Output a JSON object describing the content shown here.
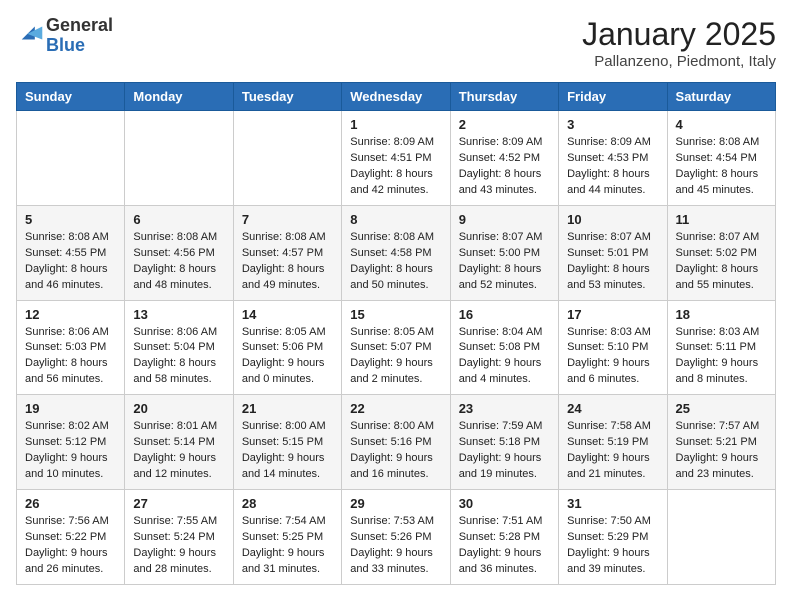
{
  "header": {
    "logo_line1": "General",
    "logo_line2": "Blue",
    "month_title": "January 2025",
    "location": "Pallanzeno, Piedmont, Italy"
  },
  "days_of_week": [
    "Sunday",
    "Monday",
    "Tuesday",
    "Wednesday",
    "Thursday",
    "Friday",
    "Saturday"
  ],
  "weeks": [
    [
      {
        "day": "",
        "text": ""
      },
      {
        "day": "",
        "text": ""
      },
      {
        "day": "",
        "text": ""
      },
      {
        "day": "1",
        "text": "Sunrise: 8:09 AM\nSunset: 4:51 PM\nDaylight: 8 hours\nand 42 minutes."
      },
      {
        "day": "2",
        "text": "Sunrise: 8:09 AM\nSunset: 4:52 PM\nDaylight: 8 hours\nand 43 minutes."
      },
      {
        "day": "3",
        "text": "Sunrise: 8:09 AM\nSunset: 4:53 PM\nDaylight: 8 hours\nand 44 minutes."
      },
      {
        "day": "4",
        "text": "Sunrise: 8:08 AM\nSunset: 4:54 PM\nDaylight: 8 hours\nand 45 minutes."
      }
    ],
    [
      {
        "day": "5",
        "text": "Sunrise: 8:08 AM\nSunset: 4:55 PM\nDaylight: 8 hours\nand 46 minutes."
      },
      {
        "day": "6",
        "text": "Sunrise: 8:08 AM\nSunset: 4:56 PM\nDaylight: 8 hours\nand 48 minutes."
      },
      {
        "day": "7",
        "text": "Sunrise: 8:08 AM\nSunset: 4:57 PM\nDaylight: 8 hours\nand 49 minutes."
      },
      {
        "day": "8",
        "text": "Sunrise: 8:08 AM\nSunset: 4:58 PM\nDaylight: 8 hours\nand 50 minutes."
      },
      {
        "day": "9",
        "text": "Sunrise: 8:07 AM\nSunset: 5:00 PM\nDaylight: 8 hours\nand 52 minutes."
      },
      {
        "day": "10",
        "text": "Sunrise: 8:07 AM\nSunset: 5:01 PM\nDaylight: 8 hours\nand 53 minutes."
      },
      {
        "day": "11",
        "text": "Sunrise: 8:07 AM\nSunset: 5:02 PM\nDaylight: 8 hours\nand 55 minutes."
      }
    ],
    [
      {
        "day": "12",
        "text": "Sunrise: 8:06 AM\nSunset: 5:03 PM\nDaylight: 8 hours\nand 56 minutes."
      },
      {
        "day": "13",
        "text": "Sunrise: 8:06 AM\nSunset: 5:04 PM\nDaylight: 8 hours\nand 58 minutes."
      },
      {
        "day": "14",
        "text": "Sunrise: 8:05 AM\nSunset: 5:06 PM\nDaylight: 9 hours\nand 0 minutes."
      },
      {
        "day": "15",
        "text": "Sunrise: 8:05 AM\nSunset: 5:07 PM\nDaylight: 9 hours\nand 2 minutes."
      },
      {
        "day": "16",
        "text": "Sunrise: 8:04 AM\nSunset: 5:08 PM\nDaylight: 9 hours\nand 4 minutes."
      },
      {
        "day": "17",
        "text": "Sunrise: 8:03 AM\nSunset: 5:10 PM\nDaylight: 9 hours\nand 6 minutes."
      },
      {
        "day": "18",
        "text": "Sunrise: 8:03 AM\nSunset: 5:11 PM\nDaylight: 9 hours\nand 8 minutes."
      }
    ],
    [
      {
        "day": "19",
        "text": "Sunrise: 8:02 AM\nSunset: 5:12 PM\nDaylight: 9 hours\nand 10 minutes."
      },
      {
        "day": "20",
        "text": "Sunrise: 8:01 AM\nSunset: 5:14 PM\nDaylight: 9 hours\nand 12 minutes."
      },
      {
        "day": "21",
        "text": "Sunrise: 8:00 AM\nSunset: 5:15 PM\nDaylight: 9 hours\nand 14 minutes."
      },
      {
        "day": "22",
        "text": "Sunrise: 8:00 AM\nSunset: 5:16 PM\nDaylight: 9 hours\nand 16 minutes."
      },
      {
        "day": "23",
        "text": "Sunrise: 7:59 AM\nSunset: 5:18 PM\nDaylight: 9 hours\nand 19 minutes."
      },
      {
        "day": "24",
        "text": "Sunrise: 7:58 AM\nSunset: 5:19 PM\nDaylight: 9 hours\nand 21 minutes."
      },
      {
        "day": "25",
        "text": "Sunrise: 7:57 AM\nSunset: 5:21 PM\nDaylight: 9 hours\nand 23 minutes."
      }
    ],
    [
      {
        "day": "26",
        "text": "Sunrise: 7:56 AM\nSunset: 5:22 PM\nDaylight: 9 hours\nand 26 minutes."
      },
      {
        "day": "27",
        "text": "Sunrise: 7:55 AM\nSunset: 5:24 PM\nDaylight: 9 hours\nand 28 minutes."
      },
      {
        "day": "28",
        "text": "Sunrise: 7:54 AM\nSunset: 5:25 PM\nDaylight: 9 hours\nand 31 minutes."
      },
      {
        "day": "29",
        "text": "Sunrise: 7:53 AM\nSunset: 5:26 PM\nDaylight: 9 hours\nand 33 minutes."
      },
      {
        "day": "30",
        "text": "Sunrise: 7:51 AM\nSunset: 5:28 PM\nDaylight: 9 hours\nand 36 minutes."
      },
      {
        "day": "31",
        "text": "Sunrise: 7:50 AM\nSunset: 5:29 PM\nDaylight: 9 hours\nand 39 minutes."
      },
      {
        "day": "",
        "text": ""
      }
    ]
  ]
}
